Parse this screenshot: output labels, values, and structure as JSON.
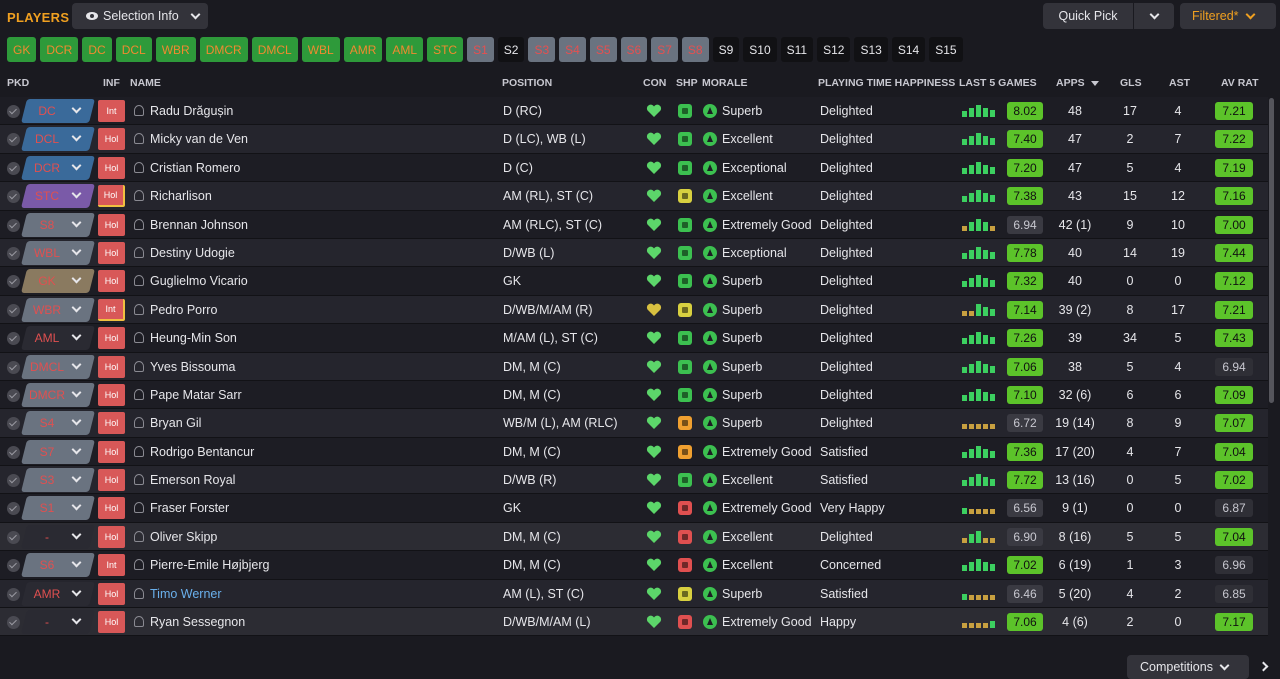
{
  "header": {
    "title": "PLAYERS",
    "selection_info": "Selection Info",
    "quick_pick": "Quick Pick",
    "filtered": "Filtered*"
  },
  "position_buttons": [
    {
      "label": "GK",
      "style": "g"
    },
    {
      "label": "DCR",
      "style": "g"
    },
    {
      "label": "DC",
      "style": "g"
    },
    {
      "label": "DCL",
      "style": "g"
    },
    {
      "label": "WBR",
      "style": "g"
    },
    {
      "label": "DMCR",
      "style": "g"
    },
    {
      "label": "DMCL",
      "style": "g"
    },
    {
      "label": "WBL",
      "style": "g"
    },
    {
      "label": "AMR",
      "style": "g"
    },
    {
      "label": "AML",
      "style": "g"
    },
    {
      "label": "STC",
      "style": "g"
    },
    {
      "label": "S1",
      "style": "s"
    },
    {
      "label": "S2",
      "style": "b"
    },
    {
      "label": "S3",
      "style": "s"
    },
    {
      "label": "S4",
      "style": "s"
    },
    {
      "label": "S5",
      "style": "s"
    },
    {
      "label": "S6",
      "style": "s"
    },
    {
      "label": "S7",
      "style": "s"
    },
    {
      "label": "S8",
      "style": "s"
    },
    {
      "label": "S9",
      "style": "b"
    },
    {
      "label": "S10",
      "style": "b"
    },
    {
      "label": "S11",
      "style": "b"
    },
    {
      "label": "S12",
      "style": "b"
    },
    {
      "label": "S13",
      "style": "b"
    },
    {
      "label": "S14",
      "style": "b"
    },
    {
      "label": "S15",
      "style": "b"
    }
  ],
  "columns": {
    "pkd": "PKD",
    "inf": "INF",
    "name": "NAME",
    "position": "POSITION",
    "con": "CON",
    "shp": "SHP",
    "morale": "MORALE",
    "pth": "PLAYING TIME HAPPINESS",
    "last5": "LAST 5 GAMES",
    "apps": "APPS",
    "gls": "GLS",
    "ast": "AST",
    "avrat": "AV RAT"
  },
  "colors": {
    "accent": "#f0a020",
    "green": "#5cc32a",
    "role_red": "#e05050",
    "inf_red": "#d85858"
  },
  "players": [
    {
      "role": "DC",
      "role_color": "#3a6a9a",
      "inf": "Int",
      "name": "Radu Drăgușin",
      "position": "D (RC)",
      "con": "#5cd66a",
      "shp": "#3cc050",
      "morale": "Superb",
      "pth": "Delighted",
      "form": [
        "g",
        "g",
        "g",
        "g",
        "g"
      ],
      "last5": "8.02",
      "last5_good": true,
      "apps": "48",
      "gls": "17",
      "ast": "4",
      "avrat": "7.21",
      "avrat_good": true
    },
    {
      "role": "DCL",
      "role_color": "#3a6a9a",
      "inf": "Hol",
      "name": "Micky van de Ven",
      "position": "D (LC), WB (L)",
      "con": "#5cd66a",
      "shp": "#3cc050",
      "morale": "Excellent",
      "pth": "Delighted",
      "form": [
        "g",
        "g",
        "g",
        "g",
        "g"
      ],
      "last5": "7.40",
      "last5_good": true,
      "apps": "47",
      "gls": "2",
      "ast": "7",
      "avrat": "7.22",
      "avrat_good": true
    },
    {
      "role": "DCR",
      "role_color": "#3a6a9a",
      "inf": "Hol",
      "name": "Cristian Romero",
      "position": "D (C)",
      "con": "#5cd66a",
      "shp": "#3cc050",
      "morale": "Exceptional",
      "pth": "Delighted",
      "form": [
        "g",
        "g",
        "g",
        "g",
        "g"
      ],
      "last5": "7.20",
      "last5_good": true,
      "apps": "47",
      "gls": "5",
      "ast": "4",
      "avrat": "7.19",
      "avrat_good": true
    },
    {
      "role": "STC",
      "role_color": "#7a5aa8",
      "inf": "Hol",
      "inf_bord": true,
      "name": "Richarlison",
      "position": "AM (RL), ST (C)",
      "con": "#5cd66a",
      "shp": "#d8d040",
      "morale": "Excellent",
      "pth": "Delighted",
      "form": [
        "g",
        "g",
        "g",
        "g",
        "g"
      ],
      "last5": "7.38",
      "last5_good": true,
      "apps": "43",
      "gls": "15",
      "ast": "12",
      "avrat": "7.16",
      "avrat_good": true
    },
    {
      "role": "S8",
      "role_color": "#6a7380",
      "inf": "Hol",
      "name": "Brennan Johnson",
      "position": "AM (RLC), ST (C)",
      "con": "#5cd66a",
      "shp": "#3cc050",
      "morale": "Extremely Good",
      "pth": "Delighted",
      "form": [
        "y",
        "g",
        "g",
        "g",
        "y"
      ],
      "last5": "6.94",
      "last5_good": false,
      "apps": "42 (1)",
      "gls": "9",
      "ast": "10",
      "avrat": "7.00",
      "avrat_good": true
    },
    {
      "role": "WBL",
      "role_color": "#6a7380",
      "inf": "Hol",
      "name": "Destiny Udogie",
      "position": "D/WB (L)",
      "con": "#5cd66a",
      "shp": "#3cc050",
      "morale": "Exceptional",
      "pth": "Delighted",
      "form": [
        "g",
        "g",
        "g",
        "g",
        "g"
      ],
      "last5": "7.78",
      "last5_good": true,
      "apps": "40",
      "gls": "14",
      "ast": "19",
      "avrat": "7.44",
      "avrat_good": true
    },
    {
      "role": "GK",
      "role_color": "#8a7a60",
      "inf": "Hol",
      "name": "Guglielmo Vicario",
      "position": "GK",
      "con": "#5cd66a",
      "shp": "#3cc050",
      "morale": "Superb",
      "pth": "Delighted",
      "form": [
        "g",
        "g",
        "g",
        "g",
        "g"
      ],
      "last5": "7.32",
      "last5_good": true,
      "apps": "40",
      "gls": "0",
      "ast": "0",
      "avrat": "7.12",
      "avrat_good": true
    },
    {
      "role": "WBR",
      "role_color": "#6a7380",
      "inf": "Int",
      "inf_bord": true,
      "name": "Pedro Porro",
      "position": "D/WB/M/AM (R)",
      "con": "#d8c040",
      "shp": "#d8d040",
      "morale": "Superb",
      "pth": "Delighted",
      "form": [
        "y",
        "y",
        "g",
        "g",
        "g"
      ],
      "last5": "7.14",
      "last5_good": true,
      "apps": "39 (2)",
      "gls": "8",
      "ast": "17",
      "avrat": "7.21",
      "avrat_good": true
    },
    {
      "role": "AML",
      "role_color": "#2a2a32",
      "inf": "Hol",
      "name": "Heung-Min Son",
      "position": "M/AM (L), ST (C)",
      "con": "#5cd66a",
      "shp": "#3cc050",
      "morale": "Superb",
      "pth": "Delighted",
      "form": [
        "g",
        "g",
        "g",
        "g",
        "g"
      ],
      "last5": "7.26",
      "last5_good": true,
      "apps": "39",
      "gls": "34",
      "ast": "5",
      "avrat": "7.43",
      "avrat_good": true
    },
    {
      "role": "DMCL",
      "role_color": "#6a7380",
      "inf": "Hol",
      "name": "Yves Bissouma",
      "position": "DM, M (C)",
      "con": "#5cd66a",
      "shp": "#3cc050",
      "morale": "Superb",
      "pth": "Delighted",
      "form": [
        "g",
        "g",
        "g",
        "g",
        "g"
      ],
      "last5": "7.06",
      "last5_good": true,
      "apps": "38",
      "gls": "5",
      "ast": "4",
      "avrat": "6.94",
      "avrat_good": false
    },
    {
      "role": "DMCR",
      "role_color": "#6a7380",
      "inf": "Hol",
      "name": "Pape Matar Sarr",
      "position": "DM, M (C)",
      "con": "#5cd66a",
      "shp": "#3cc050",
      "morale": "Superb",
      "pth": "Delighted",
      "form": [
        "g",
        "g",
        "g",
        "g",
        "g"
      ],
      "last5": "7.10",
      "last5_good": true,
      "apps": "32 (6)",
      "gls": "6",
      "ast": "6",
      "avrat": "7.09",
      "avrat_good": true
    },
    {
      "role": "S4",
      "role_color": "#6a7380",
      "inf": "Hol",
      "name": "Bryan Gil",
      "position": "WB/M (L), AM (RLC)",
      "con": "#5cd66a",
      "shp": "#f0a030",
      "morale": "Superb",
      "pth": "Delighted",
      "form": [
        "y",
        "y",
        "y",
        "y",
        "y"
      ],
      "last5": "6.72",
      "last5_good": false,
      "apps": "19 (14)",
      "gls": "8",
      "ast": "9",
      "avrat": "7.07",
      "avrat_good": true
    },
    {
      "role": "S7",
      "role_color": "#6a7380",
      "inf": "Hol",
      "name": "Rodrigo Bentancur",
      "position": "DM, M (C)",
      "con": "#5cd66a",
      "shp": "#f0a030",
      "morale": "Extremely Good",
      "pth": "Satisfied",
      "form": [
        "g",
        "g",
        "g",
        "g",
        "g"
      ],
      "last5": "7.36",
      "last5_good": true,
      "apps": "17 (20)",
      "gls": "4",
      "ast": "7",
      "avrat": "7.04",
      "avrat_good": true
    },
    {
      "role": "S3",
      "role_color": "#6a7380",
      "inf": "Hol",
      "name": "Emerson Royal",
      "position": "D/WB (R)",
      "con": "#5cd66a",
      "shp": "#3cc050",
      "morale": "Excellent",
      "pth": "Satisfied",
      "form": [
        "g",
        "g",
        "g",
        "g",
        "g"
      ],
      "last5": "7.72",
      "last5_good": true,
      "apps": "13 (16)",
      "gls": "0",
      "ast": "5",
      "avrat": "7.02",
      "avrat_good": true
    },
    {
      "role": "S1",
      "role_color": "#6a7380",
      "inf": "Hol",
      "name": "Fraser Forster",
      "position": "GK",
      "con": "#5cd66a",
      "shp": "#e05050",
      "morale": "Extremely Good",
      "pth": "Very Happy",
      "form": [
        "g",
        "y",
        "y",
        "y",
        "y"
      ],
      "last5": "6.56",
      "last5_good": false,
      "apps": "9 (1)",
      "gls": "0",
      "ast": "0",
      "avrat": "6.87",
      "avrat_good": false
    },
    {
      "role": "-",
      "role_color": "#2a2a32",
      "inf": "Hol",
      "name": "Oliver Skipp",
      "position": "DM, M (C)",
      "con": "#5cd66a",
      "shp": "#e05050",
      "morale": "Excellent",
      "pth": "Delighted",
      "form": [
        "y",
        "g",
        "g",
        "y",
        "y"
      ],
      "last5": "6.90",
      "last5_good": false,
      "apps": "8 (16)",
      "gls": "5",
      "ast": "5",
      "avrat": "7.04",
      "avrat_good": true
    },
    {
      "role": "S6",
      "role_color": "#6a7380",
      "inf": "Int",
      "name": "Pierre-Emile Højbjerg",
      "position": "DM, M (C)",
      "con": "#5cd66a",
      "shp": "#e05050",
      "morale": "Excellent",
      "pth": "Concerned",
      "form": [
        "g",
        "g",
        "g",
        "g",
        "g"
      ],
      "last5": "7.02",
      "last5_good": true,
      "apps": "6 (19)",
      "gls": "1",
      "ast": "3",
      "avrat": "6.96",
      "avrat_good": false
    },
    {
      "role": "AMR",
      "role_color": "#2a2a32",
      "inf": "Hol",
      "name": "Timo Werner",
      "name_link": true,
      "position": "AM (L), ST (C)",
      "con": "#5cd66a",
      "shp": "#d8d040",
      "morale": "Superb",
      "pth": "Satisfied",
      "form": [
        "g",
        "y",
        "y",
        "y",
        "y"
      ],
      "last5": "6.46",
      "last5_good": false,
      "apps": "5 (20)",
      "gls": "4",
      "ast": "2",
      "avrat": "6.85",
      "avrat_good": false
    },
    {
      "role": "-",
      "role_color": "#2a2a32",
      "inf": "Hol",
      "name": "Ryan Sessegnon",
      "position": "D/WB/M/AM (L)",
      "con": "#5cd66a",
      "shp": "#e05050",
      "morale": "Extremely Good",
      "pth": "Happy",
      "form": [
        "y",
        "y",
        "y",
        "y",
        "g"
      ],
      "last5": "7.06",
      "last5_good": true,
      "apps": "4 (6)",
      "gls": "2",
      "ast": "0",
      "avrat": "7.17",
      "avrat_good": true
    }
  ],
  "footer": {
    "competitions": "Competitions"
  }
}
